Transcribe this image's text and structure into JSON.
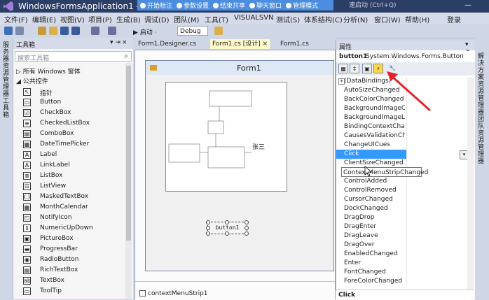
{
  "window": {
    "title": "WindowsFormsApplication1 - Mic",
    "search_placeholder": "速启动 (Ctrl+Q)",
    "minimize_label": "—",
    "login_label": "登录"
  },
  "overlay_toolbar": {
    "items": [
      "开始标注",
      "参数设置",
      "结束共享",
      "聊天窗口",
      "管理模式"
    ]
  },
  "menu": {
    "items": [
      "文件(F)",
      "编辑(E)",
      "视图(V)",
      "项目(P)",
      "生成(B)",
      "调试(D)",
      "团队(M)",
      "工具(T)",
      "VISUALSVN",
      "测试(S)",
      "体系结构(C)",
      "分析(N)",
      "窗口(W)",
      "帮助(H)"
    ]
  },
  "toolbar": {
    "start_label": "▶ 启动 ·",
    "config_value": "Debug"
  },
  "toolbox": {
    "tab_label": "服务器资源管理器 工具箱",
    "title": "工具箱",
    "pin": "▾ ⇥",
    "close": "×",
    "search_placeholder": "搜索工具箱",
    "groups": [
      "▷ 所有 Windows 窗体",
      "◢ 公共控件"
    ],
    "tools": [
      {
        "icon": "↖",
        "label": "指针"
      },
      {
        "icon": "▭",
        "label": "Button"
      },
      {
        "icon": "☑",
        "label": "CheckBox"
      },
      {
        "icon": "≡",
        "label": "CheckedListBox"
      },
      {
        "icon": "▤",
        "label": "ComboBox"
      },
      {
        "icon": "▦",
        "label": "DateTimePicker"
      },
      {
        "icon": "A",
        "label": "Label"
      },
      {
        "icon": "A",
        "label": "LinkLabel"
      },
      {
        "icon": "≣",
        "label": "ListBox"
      },
      {
        "icon": "☷",
        "label": "ListView"
      },
      {
        "icon": "(.)",
        "label": "MaskedTextBox"
      },
      {
        "icon": "▦",
        "label": "MonthCalendar"
      },
      {
        "icon": "◰",
        "label": "NotifyIcon"
      },
      {
        "icon": "⇕",
        "label": "NumericUpDown"
      },
      {
        "icon": "▣",
        "label": "PictureBox"
      },
      {
        "icon": "▬",
        "label": "ProgressBar"
      },
      {
        "icon": "◉",
        "label": "RadioButton"
      },
      {
        "icon": "▤",
        "label": "RichTextBox"
      },
      {
        "icon": "ab",
        "label": "TextBox"
      },
      {
        "icon": "▭",
        "label": "ToolTip"
      }
    ]
  },
  "editor": {
    "tabs": [
      "Form1.Designer.cs",
      "Form1.cs [设计]",
      "Form1.cs"
    ],
    "tab_close": "×",
    "form_title": "Form1",
    "label_zhangsan": "张三",
    "button_text": "button1",
    "tray_item": "contextMenuStrip1"
  },
  "properties": {
    "title": "属性",
    "close": "▾ ×",
    "object_name": "button1",
    "object_type": "System.Windows.Forms.Button",
    "toolbar_buttons": [
      "▦",
      "↕",
      "▣",
      "⚡",
      "🔧"
    ],
    "events": [
      "(DataBindings)",
      "AutoSizeChanged",
      "BackColorChanged",
      "BackgroundImageCh",
      "BackgroundImageLay",
      "BindingContextChang",
      "CausesValidationChan",
      "ChangeUICues",
      "Click",
      "ClientSizeChanged",
      "ContextMenuStripChanged",
      "ControlAdded",
      "ControlRemoved",
      "CursorChanged",
      "DockChanged",
      "DragDrop",
      "DragEnter",
      "DragLeave",
      "DragOver",
      "EnabledChanged",
      "Enter",
      "FontChanged",
      "ForeColorChanged"
    ],
    "selected_event": "Click",
    "tooltip": "ContextMenuStripChanged",
    "description": "Click",
    "expand_symbol": "+",
    "dropdown_symbol": "▾"
  },
  "side_strip": {
    "label": "解决方案资源管理器 团队资源管理器"
  },
  "colors": {
    "title_bar": "#2c3e66",
    "selection": "#3399ff",
    "arrow": "#e8202a"
  }
}
